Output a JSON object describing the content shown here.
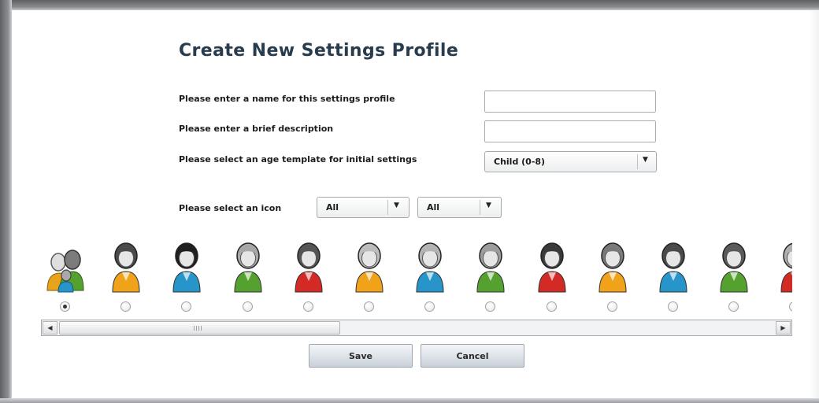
{
  "page": {
    "title": "Create New Settings Profile"
  },
  "form": {
    "name_label": "Please enter a name for this settings profile",
    "name_value": "",
    "description_label": "Please enter a brief description",
    "description_value": "",
    "age_label": "Please select an age template for initial settings",
    "age_selected": "Child (0-8)",
    "icon_label": "Please select an icon",
    "icon_filter_1": "All",
    "icon_filter_2": "All"
  },
  "icons": [
    {
      "name": "family-group-icon",
      "shirt": "#e8a31b",
      "hair": "#6d6d6d",
      "selected": true
    },
    {
      "name": "woman-curly-orange-icon",
      "shirt": "#f0a21a",
      "hair": "#4a4a4a",
      "selected": false
    },
    {
      "name": "woman-dark-blue-icon",
      "shirt": "#2795c9",
      "hair": "#1f1f1f",
      "selected": false
    },
    {
      "name": "woman-green-icon",
      "shirt": "#55a130",
      "hair": "#a7a7a7",
      "selected": false
    },
    {
      "name": "woman-red-icon",
      "shirt": "#d42a25",
      "hair": "#555555",
      "selected": false
    },
    {
      "name": "girl-braids-orange-icon",
      "shirt": "#f0a21a",
      "hair": "#bdbdbd",
      "selected": false
    },
    {
      "name": "girl-braids-blue-icon",
      "shirt": "#2795c9",
      "hair": "#b3b3b3",
      "selected": false
    },
    {
      "name": "man-green-icon",
      "shirt": "#55a130",
      "hair": "#9c9c9c",
      "selected": false
    },
    {
      "name": "man-red-icon",
      "shirt": "#d42a25",
      "hair": "#3a3a3a",
      "selected": false
    },
    {
      "name": "man-beard-orange-icon",
      "shirt": "#f0a21a",
      "hair": "#7a7a7a",
      "selected": false
    },
    {
      "name": "man-blue-icon",
      "shirt": "#2795c9",
      "hair": "#4a4a4a",
      "selected": false
    },
    {
      "name": "boy-green-icon",
      "shirt": "#55a130",
      "hair": "#5a5a5a",
      "selected": false
    },
    {
      "name": "man-red-partial-icon",
      "shirt": "#d42a25",
      "hair": "#b0b0b0",
      "selected": false
    }
  ],
  "buttons": {
    "save": "Save",
    "cancel": "Cancel"
  },
  "scrollbar": {
    "position": 0.0
  }
}
